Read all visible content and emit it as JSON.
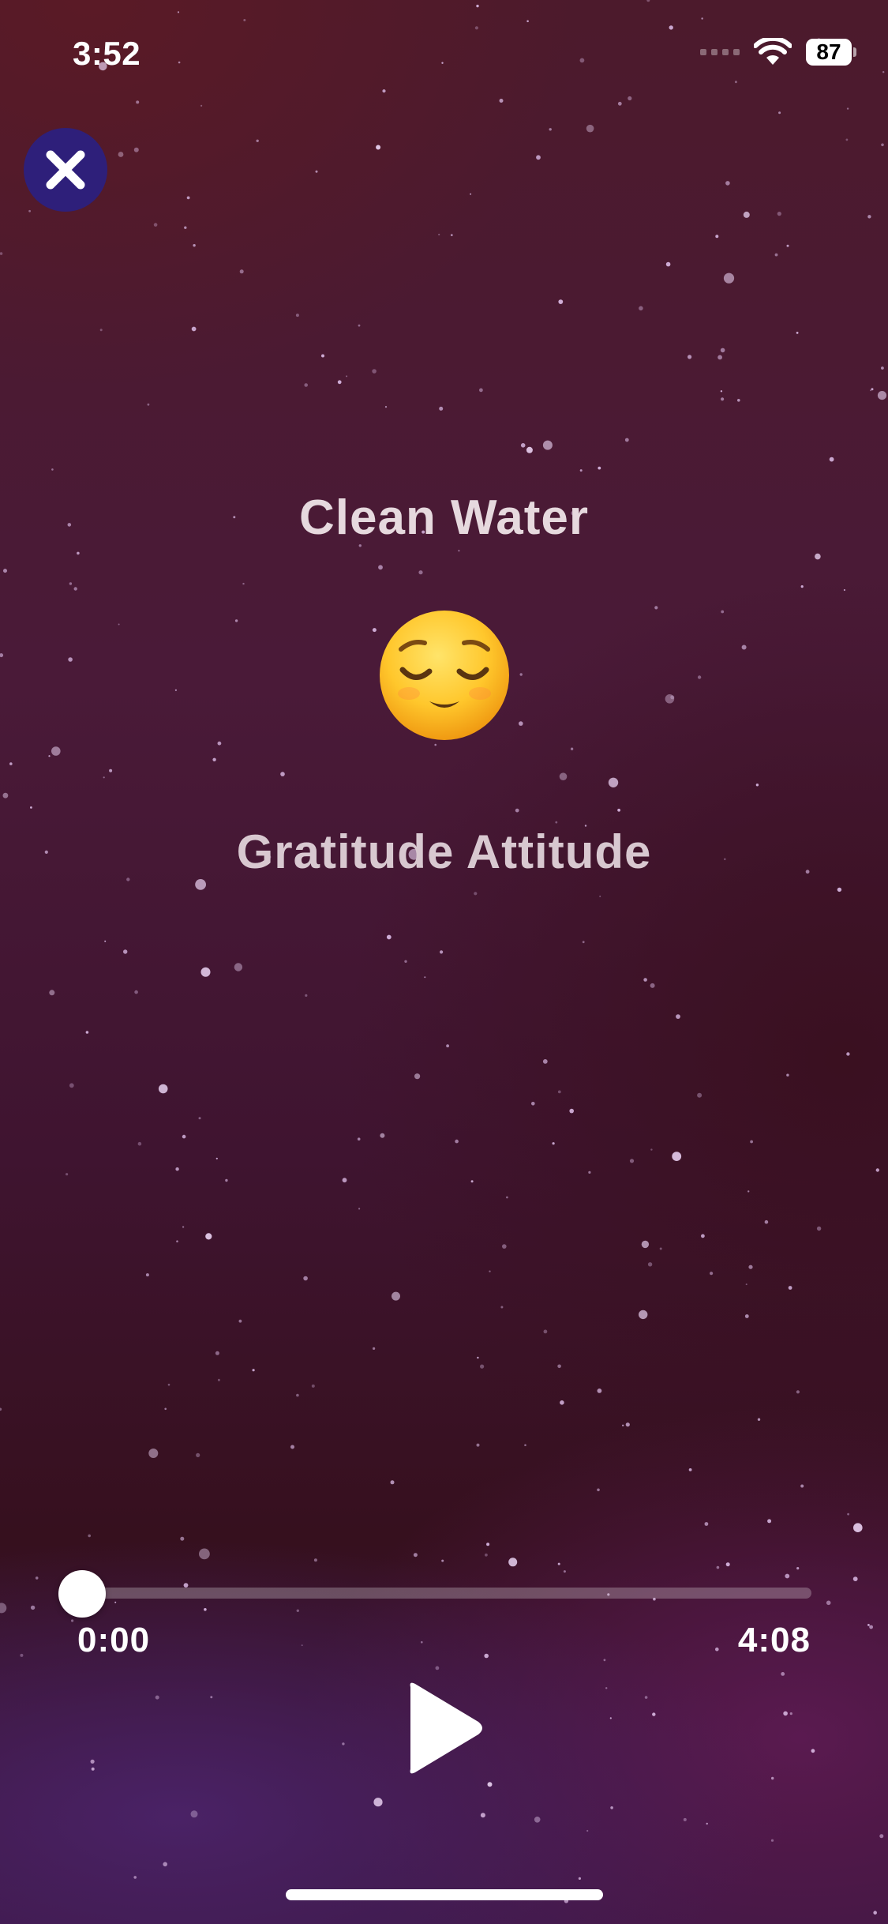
{
  "status_bar": {
    "time": "3:52",
    "battery": "87",
    "icons": [
      "signal-icon",
      "wifi-icon",
      "battery-icon"
    ]
  },
  "close_button": {
    "icon": "close-icon",
    "color": "#2e1f7a"
  },
  "track": {
    "title": "Clean Water",
    "emoji": "relieved-face",
    "subtitle": "Gratitude Attitude"
  },
  "player": {
    "current_time": "0:00",
    "total_time": "4:08",
    "progress": 0.0,
    "play_icon": "play-icon"
  }
}
